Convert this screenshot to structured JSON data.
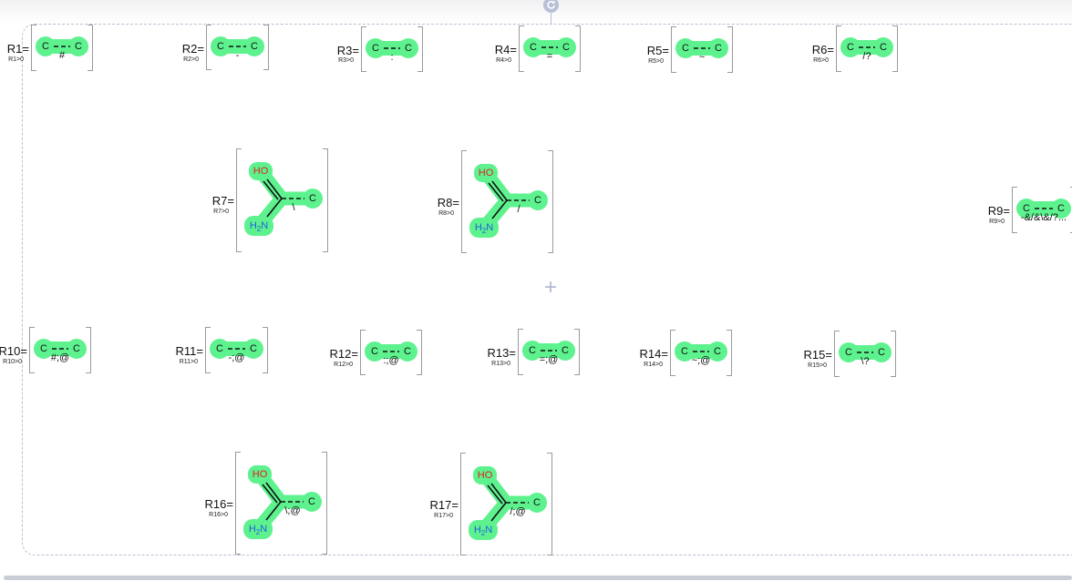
{
  "colors": {
    "highlight": "#5ef28f",
    "oxygen": "#e0201b",
    "nitrogen": "#2060e0",
    "frame": "#b9bfd3",
    "bracket": "#9a9a9a"
  },
  "icons": {
    "rotate": "rotate-icon",
    "plus": "plus-icon"
  },
  "plus_sign": "+",
  "groups": [
    {
      "label": "R1=",
      "condition": "R1>0",
      "kind": "ethyne",
      "atoms": [
        "C",
        "C"
      ],
      "bond_label": "#"
    },
    {
      "label": "R2=",
      "condition": "R2>0",
      "kind": "ethyne",
      "atoms": [
        "C",
        "C"
      ],
      "bond_label": "-"
    },
    {
      "label": "R3=",
      "condition": "R3>0",
      "kind": "ethyne",
      "atoms": [
        "C",
        "C"
      ],
      "bond_label": ":"
    },
    {
      "label": "R4=",
      "condition": "R4>0",
      "kind": "ethyne",
      "atoms": [
        "C",
        "C"
      ],
      "bond_label": "="
    },
    {
      "label": "R5=",
      "condition": "R5>0",
      "kind": "ethyne",
      "atoms": [
        "C",
        "C"
      ],
      "bond_label": "~"
    },
    {
      "label": "R6=",
      "condition": "R6>0",
      "kind": "ethyne",
      "atoms": [
        "C",
        "C"
      ],
      "bond_label": "/?"
    },
    {
      "label": "R7=",
      "condition": "R7>0",
      "kind": "branched",
      "atoms": [
        "HO",
        "H2N",
        "C"
      ],
      "bond_label": "\\"
    },
    {
      "label": "R8=",
      "condition": "R8>0",
      "kind": "branched",
      "atoms": [
        "HO",
        "H2N",
        "C"
      ],
      "bond_label": "/"
    },
    {
      "label": "R9=",
      "condition": "R9>0",
      "kind": "ethyne",
      "atoms": [
        "C",
        "C"
      ],
      "bond_label": "-&/&\\&/?..."
    },
    {
      "label": "R10=",
      "condition": "R10>0",
      "kind": "ethyne",
      "atoms": [
        "C",
        "C"
      ],
      "bond_label": "#;@"
    },
    {
      "label": "R11=",
      "condition": "R11>0",
      "kind": "ethyne",
      "atoms": [
        "C",
        "C"
      ],
      "bond_label": "-;@"
    },
    {
      "label": "R12=",
      "condition": "R12>0",
      "kind": "ethyne",
      "atoms": [
        "C",
        "C"
      ],
      "bond_label": ":;@"
    },
    {
      "label": "R13=",
      "condition": "R13>0",
      "kind": "ethyne",
      "atoms": [
        "C",
        "C"
      ],
      "bond_label": "=;@"
    },
    {
      "label": "R14=",
      "condition": "R14>0",
      "kind": "ethyne",
      "atoms": [
        "C",
        "C"
      ],
      "bond_label": "~;@"
    },
    {
      "label": "R15=",
      "condition": "R15>0",
      "kind": "ethyne",
      "atoms": [
        "C",
        "C"
      ],
      "bond_label": "\\?"
    },
    {
      "label": "R16=",
      "condition": "R16>0",
      "kind": "branched",
      "atoms": [
        "HO",
        "H2N",
        "C"
      ],
      "bond_label": "\\;@"
    },
    {
      "label": "R17=",
      "condition": "R17>0",
      "kind": "branched",
      "atoms": [
        "HO",
        "H2N",
        "C"
      ],
      "bond_label": "/;@"
    }
  ]
}
